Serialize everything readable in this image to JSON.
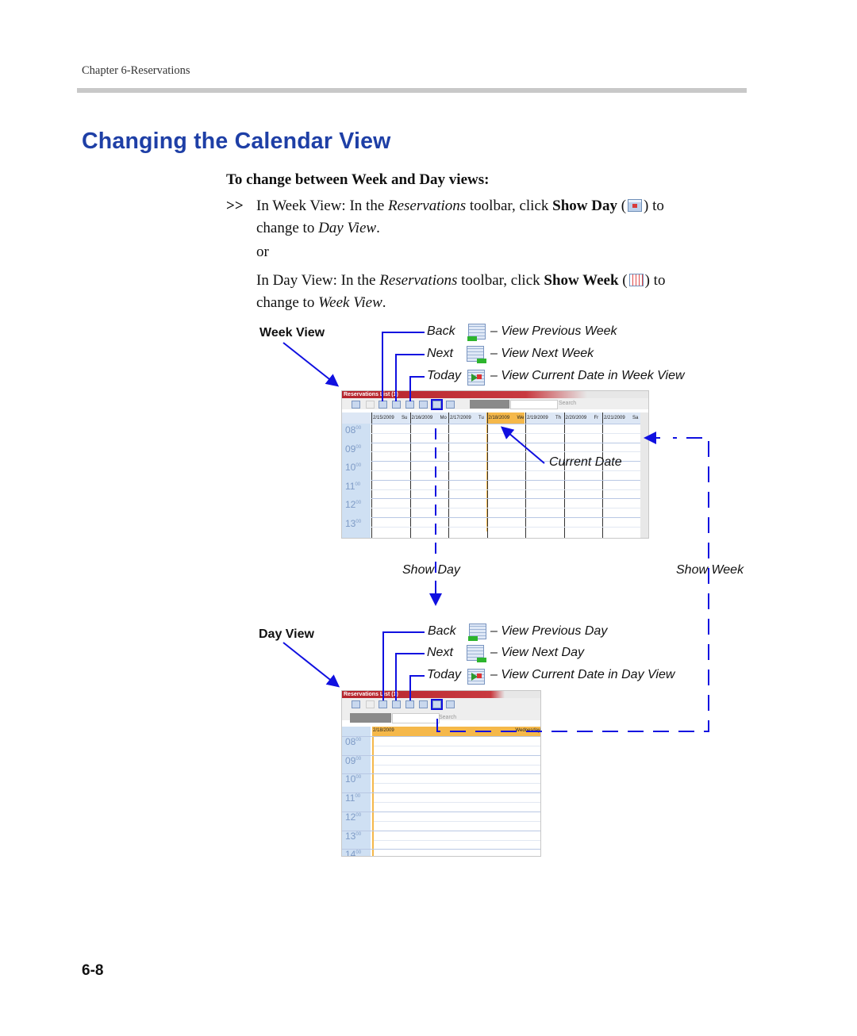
{
  "header": {
    "chapter": "Chapter 6-Reservations"
  },
  "title": "Changing the Calendar View",
  "procedure": {
    "heading": "To change between Week and Day views:",
    "bullet": ">>",
    "step1": {
      "pre": "In Week View: In the ",
      "toolbar": "Reservations",
      "mid": " toolbar, click ",
      "button": "Show Day",
      "post1": " (",
      "post2": ") to",
      "line2_pre": "change to ",
      "view": "Day View",
      "line2_post": "."
    },
    "or": "or",
    "step2": {
      "pre": "In Day View: In the ",
      "toolbar": "Reservations",
      "mid": " toolbar, click ",
      "button": "Show Week",
      "post1": " (",
      "post2": ") to",
      "line2_pre": "change to ",
      "view": "Week View",
      "line2_post": "."
    }
  },
  "diagram": {
    "week": {
      "label": "Week View",
      "items": [
        {
          "name": "Back",
          "desc": "– View Previous Week",
          "icon": "calendar-back-icon"
        },
        {
          "name": "Next",
          "desc": "– View Next Week",
          "icon": "calendar-next-icon"
        },
        {
          "name": "Today",
          "desc": "– View Current Date in Week View",
          "icon": "calendar-today-icon"
        }
      ],
      "current_date": "Current Date",
      "screenshot": {
        "title": "Reservations List (1)",
        "search": "Search",
        "days": [
          "2/15/2009",
          "Su",
          "2/16/2009",
          "Mo",
          "2/17/2009",
          "Tu",
          "2/18/2009",
          "We",
          "2/19/2009",
          "Th",
          "2/20/2009",
          "Fr",
          "2/21/2009",
          "Sa"
        ],
        "hours": [
          "08",
          "09",
          "10",
          "11",
          "12",
          "13"
        ],
        "minutes": "00"
      }
    },
    "show_day": "Show Day",
    "show_week": "Show Week",
    "day": {
      "label": "Day View",
      "items": [
        {
          "name": "Back",
          "desc": "– View Previous Day",
          "icon": "calendar-back-icon"
        },
        {
          "name": "Next",
          "desc": "– View Next Day",
          "icon": "calendar-next-icon"
        },
        {
          "name": "Today",
          "desc": "– View Current Date in Day View",
          "icon": "calendar-today-icon"
        }
      ],
      "screenshot": {
        "title": "Reservations List (1)",
        "search": "Search",
        "date": "2/18/2009",
        "weekday": "Wednesday",
        "hours": [
          "08",
          "09",
          "10",
          "11",
          "12",
          "13",
          "14"
        ],
        "minutes": "00"
      }
    },
    "colors": {
      "arrow": "#1010e0",
      "current_day": "#f5b84a",
      "title": "#1e3fa6"
    }
  },
  "footer": {
    "page_number": "6-8"
  }
}
